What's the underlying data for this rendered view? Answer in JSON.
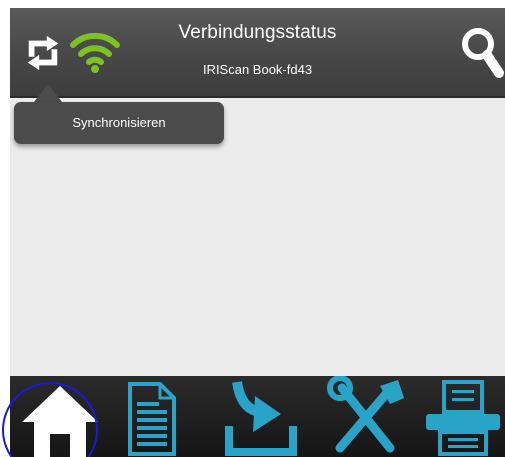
{
  "header": {
    "title": "Verbindungsstatus",
    "subtitle": "IRIScan Book-fd43"
  },
  "tooltip": {
    "label": "Synchronisieren"
  },
  "icons": {
    "sync": "sync-icon",
    "wifi": "wifi-icon",
    "search": "search-icon",
    "home": "home-icon",
    "documents": "document-icon",
    "import": "import-icon",
    "settings": "settings-tools-icon",
    "scanner": "scanner-icon"
  },
  "colors": {
    "header_bg": "#4a4a4a",
    "wifi_green": "#7cc31d",
    "nav_accent": "#29a3c7",
    "content_bg": "#ececec",
    "highlight_ring": "#1a1ad8"
  }
}
